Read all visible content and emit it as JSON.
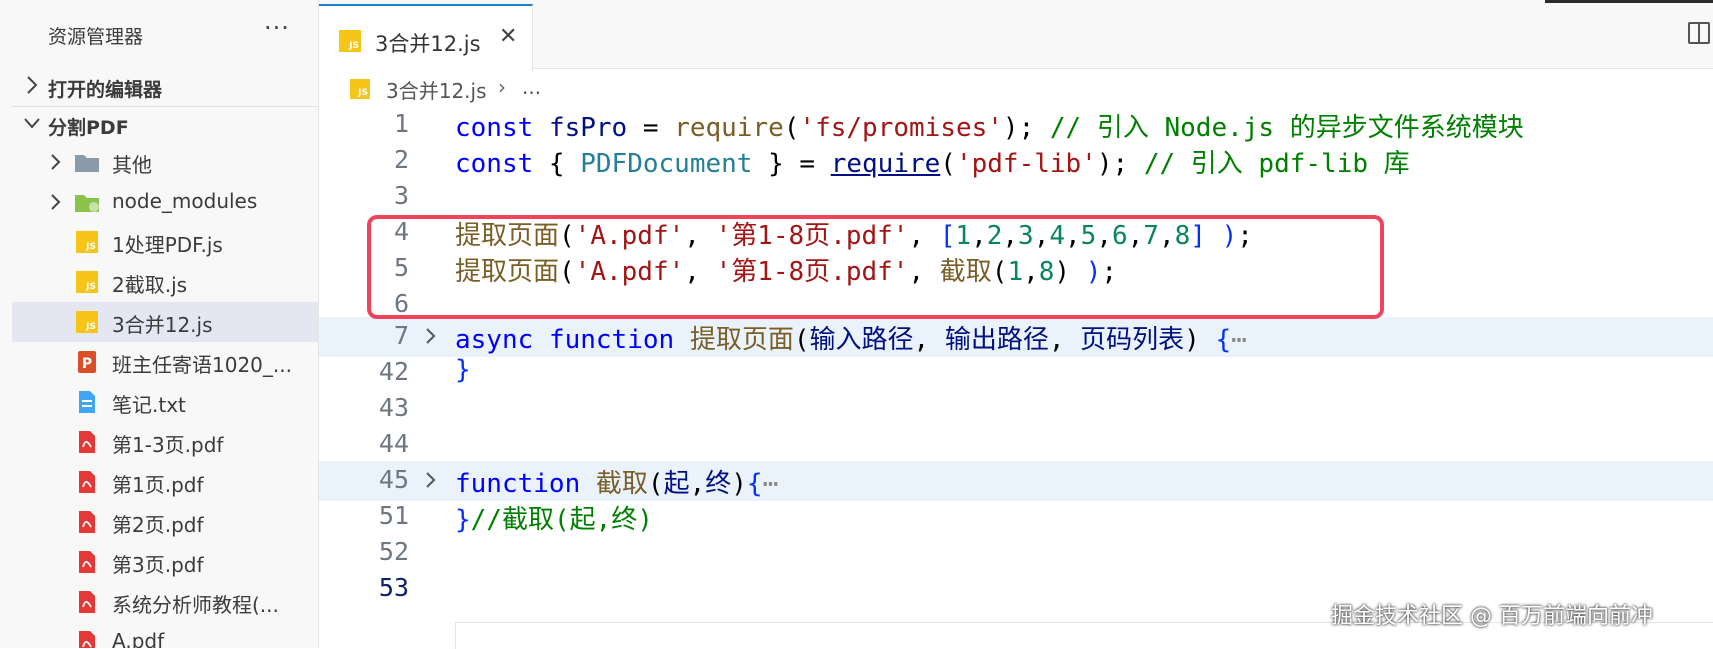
{
  "sidebar": {
    "header": "资源管理器",
    "more": "···",
    "sections": [
      {
        "label": "打开的编辑器",
        "expanded": false
      },
      {
        "label": "分割PDF",
        "expanded": true
      }
    ],
    "items": [
      {
        "label": "其他",
        "type": "folder",
        "icon": "folder-icon",
        "expandable": true
      },
      {
        "label": "node_modules",
        "type": "folder",
        "icon": "node-folder-icon",
        "expandable": true
      },
      {
        "label": "1处理PDF.js",
        "type": "file",
        "icon": "js-file-icon"
      },
      {
        "label": "2截取.js",
        "type": "file",
        "icon": "js-file-icon"
      },
      {
        "label": "3合并12.js",
        "type": "file",
        "icon": "js-file-icon",
        "selected": true
      },
      {
        "label": "班主任寄语1020_...",
        "type": "file",
        "icon": "ppt-file-icon"
      },
      {
        "label": "笔记.txt",
        "type": "file",
        "icon": "txt-file-icon"
      },
      {
        "label": "第1-3页.pdf",
        "type": "file",
        "icon": "pdf-file-icon"
      },
      {
        "label": "第1页.pdf",
        "type": "file",
        "icon": "pdf-file-icon"
      },
      {
        "label": "第2页.pdf",
        "type": "file",
        "icon": "pdf-file-icon"
      },
      {
        "label": "第3页.pdf",
        "type": "file",
        "icon": "pdf-file-icon"
      },
      {
        "label": "系统分析师教程(...",
        "type": "file",
        "icon": "pdf-file-icon"
      },
      {
        "label": "A.pdf",
        "type": "file",
        "icon": "pdf-file-icon"
      }
    ]
  },
  "tab": {
    "label": "3合并12.js",
    "close": "✕"
  },
  "breadcrumb": {
    "file": "3合并12.js",
    "sep": "›",
    "more": "..."
  },
  "editor": {
    "line_numbers": [
      "1",
      "2",
      "3",
      "4",
      "5",
      "6",
      "7",
      "42",
      "43",
      "44",
      "45",
      "51",
      "52",
      "53"
    ],
    "active_line": "53",
    "fold_lines": [
      "7",
      "45"
    ]
  },
  "colors": {
    "accent": "#1f7fd2",
    "highlight_box": "#f0435c",
    "selected_row": "#e4e6f1"
  },
  "watermark": "掘金技术社区 @ 百万前端向前冲"
}
